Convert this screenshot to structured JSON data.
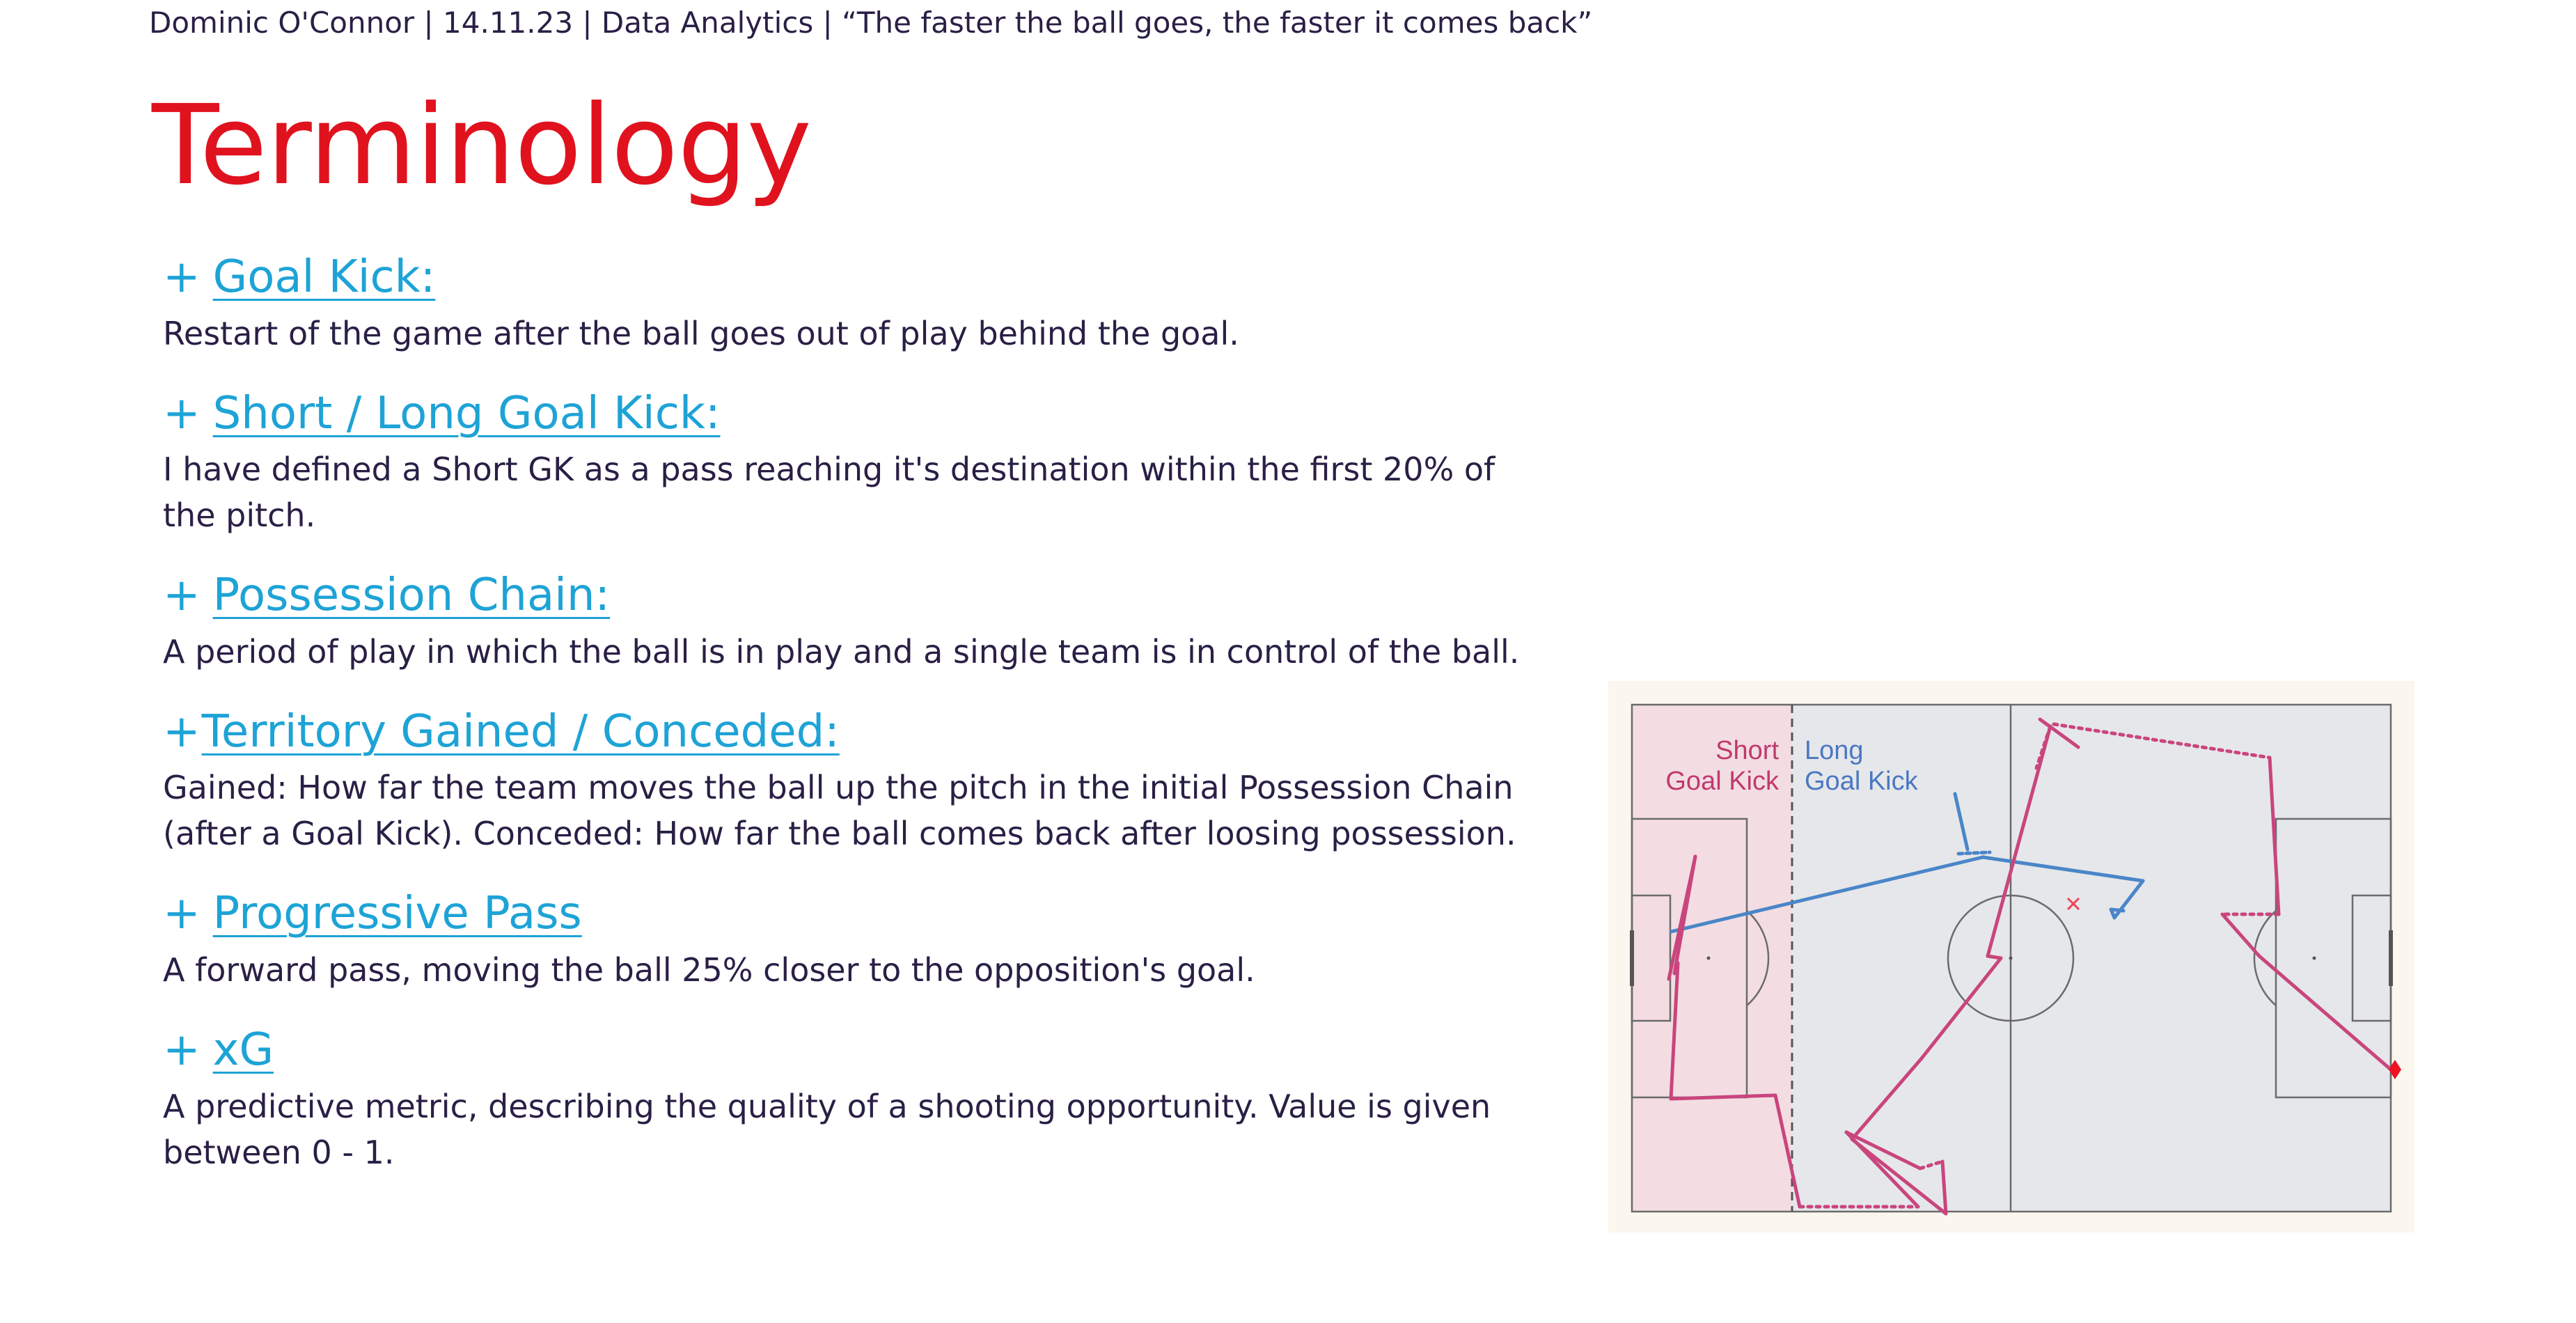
{
  "header": {
    "text": "Dominic O'Connor | 14.11.23 | Data Analytics | “The faster the ball goes, the faster it comes back”"
  },
  "page": {
    "title": "Terminology"
  },
  "terms": [
    {
      "plus": "+",
      "title": "Goal Kick:",
      "description": "Restart of the game after the ball goes out of play behind the goal."
    },
    {
      "plus": "+",
      "title": "Short / Long Goal Kick:",
      "description": "I have defined a Short GK as a pass reaching it's destination within the first 20% of the pitch."
    },
    {
      "plus": "+",
      "title": "Possession Chain:",
      "description": "A period of play in which the ball is in play and a single team is in control of the ball."
    },
    {
      "plus": "+",
      "title": "Territory Gained / Conceded:",
      "description": "Gained: How far the team moves the ball up the pitch in the initial Possession Chain (after a Goal Kick). Conceded: How far the ball comes back after loosing possession."
    },
    {
      "plus": "+",
      "title": "Progressive Pass",
      "description": "A forward pass, moving the ball 25% closer to the opposition's goal."
    },
    {
      "plus": "+",
      "title": "xG",
      "description": "A predictive metric, describing the quality of a shooting opportunity. Value is given between 0 - 1."
    }
  ],
  "diagram": {
    "short_label_line1": "Short",
    "short_label_line2": "Goal Kick",
    "long_label_line1": "Long",
    "long_label_line2": "Goal Kick",
    "colors": {
      "short_zone": "#f3dde2",
      "pitch": "#e6e7ea",
      "pitch_lines": "#6b6b6b",
      "short_text": "#c0396e",
      "long_text": "#4a78c2",
      "pink_path": "#c9457d",
      "blue_path": "#4a86c8",
      "shot_marker": "#ee1122",
      "loss_marker": "#ee4455",
      "background": "#fbf7ee"
    }
  }
}
